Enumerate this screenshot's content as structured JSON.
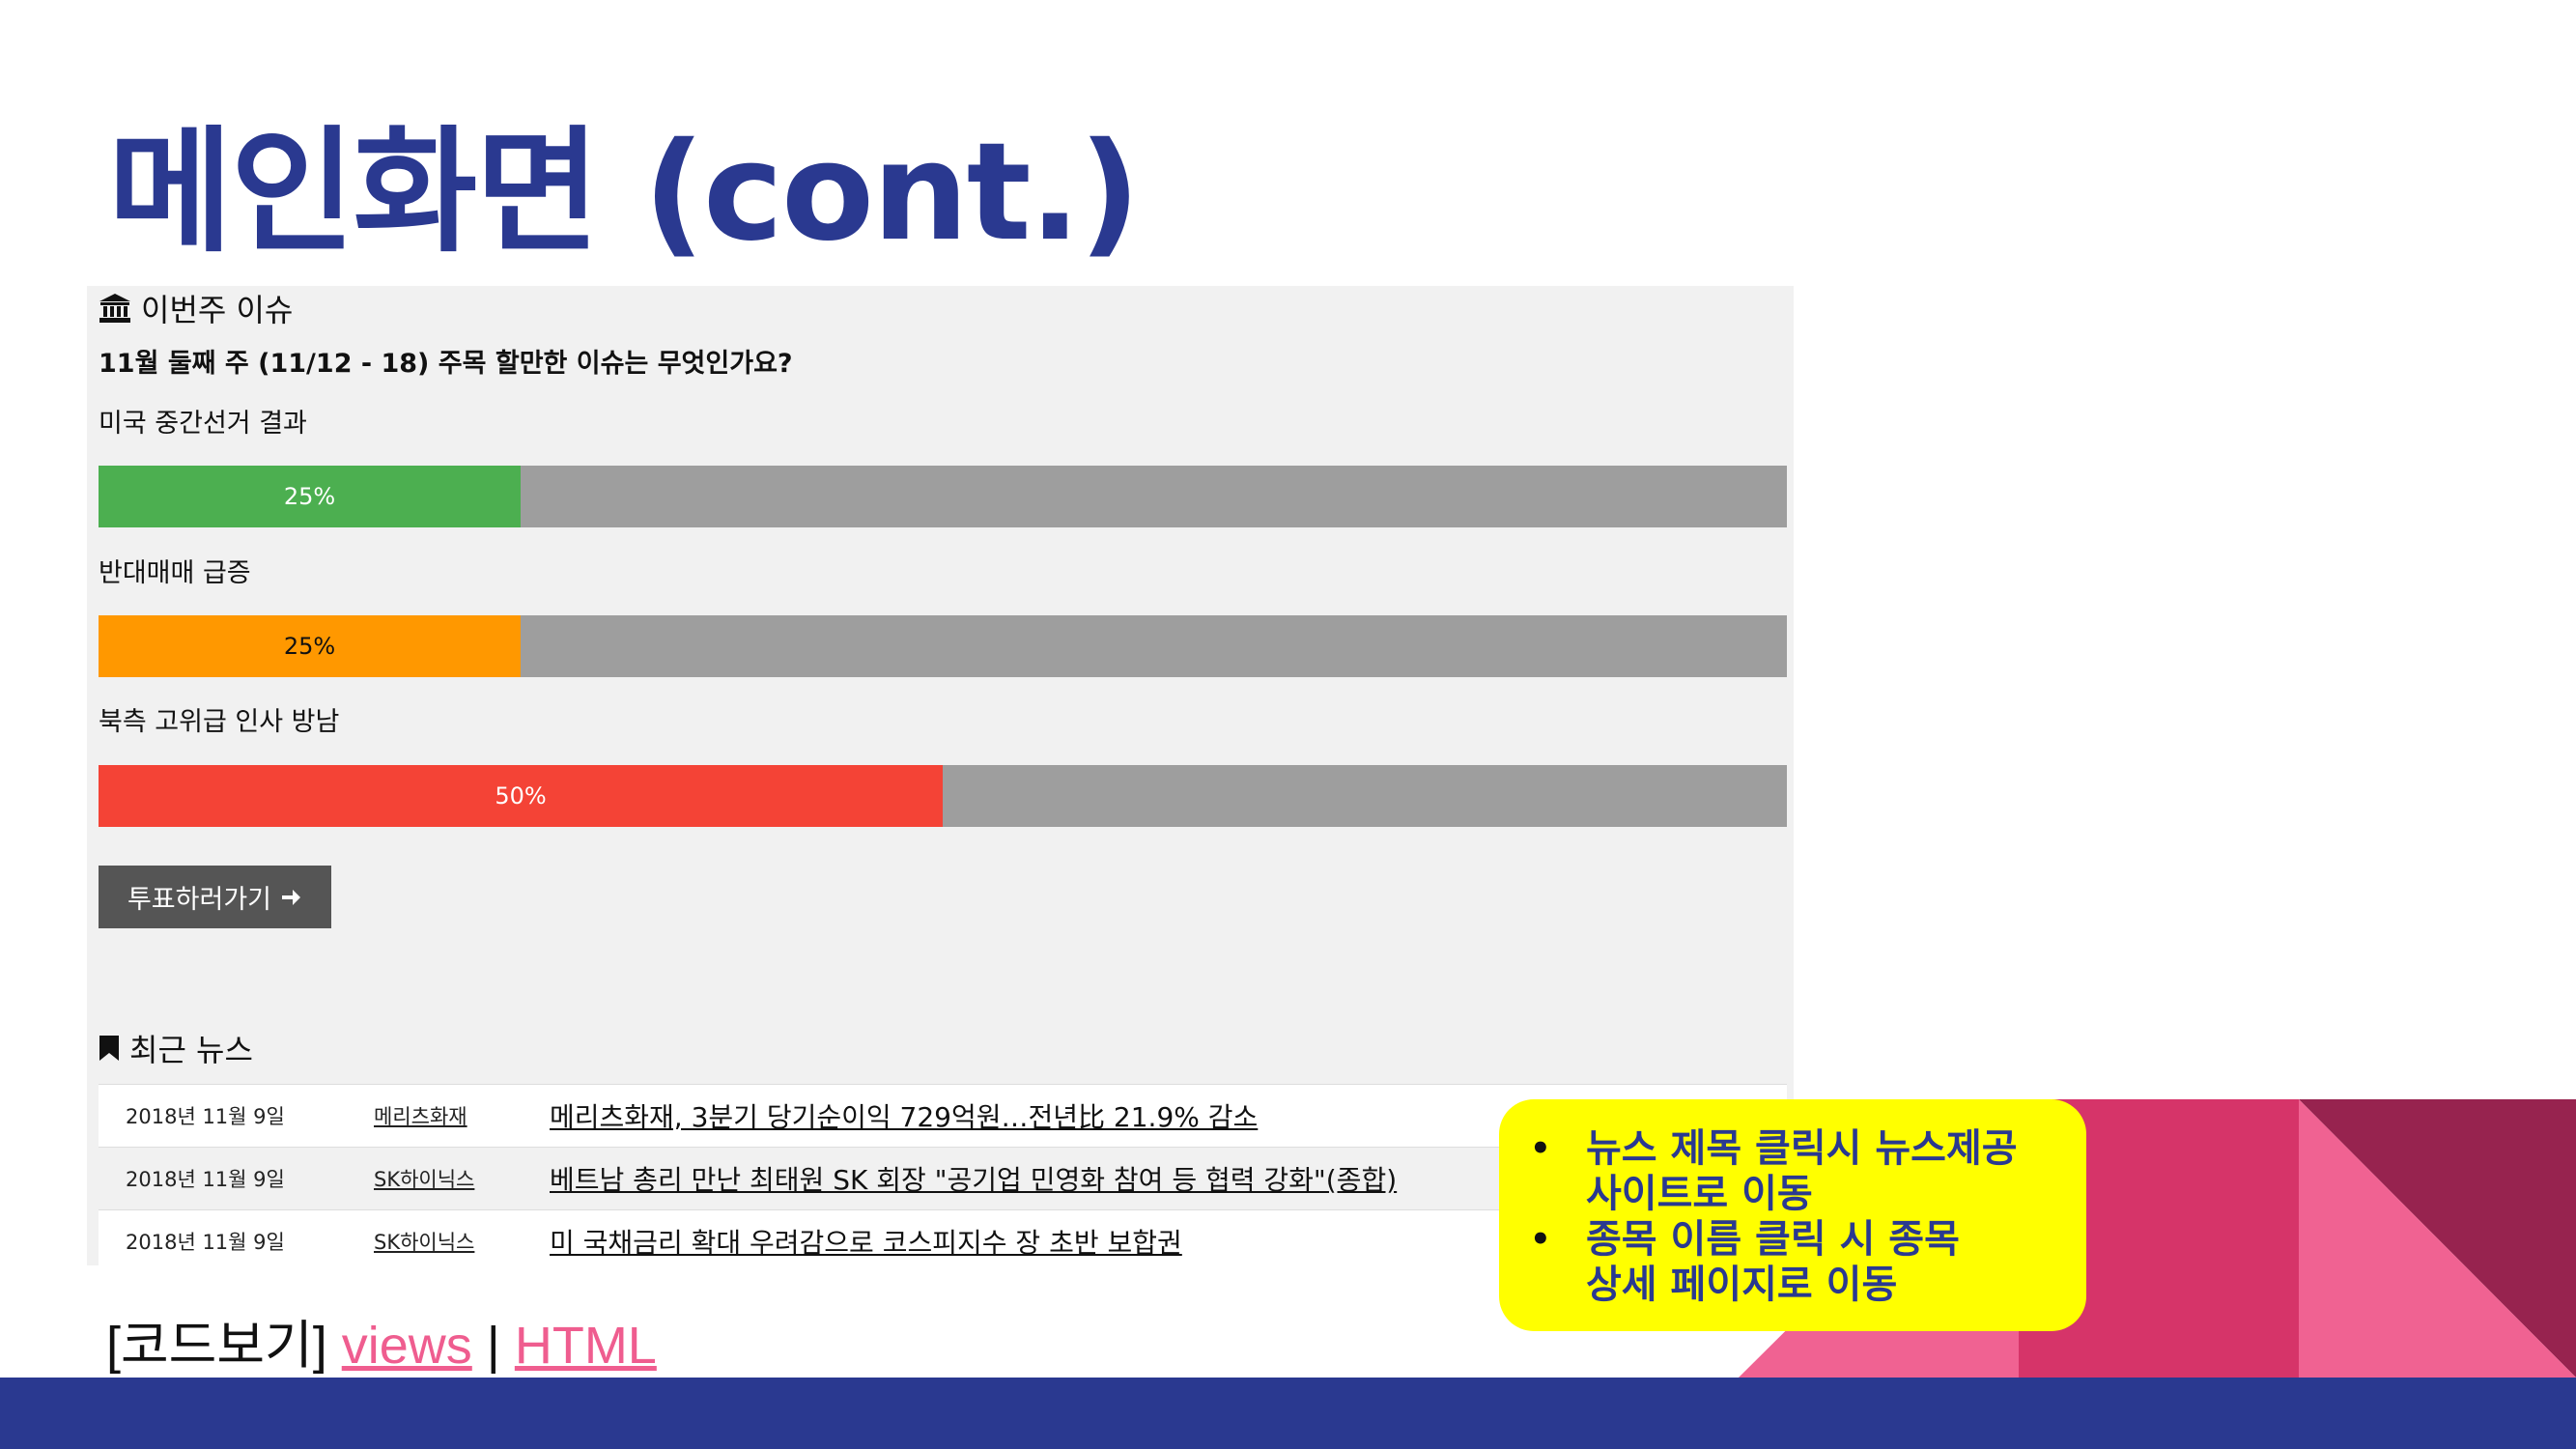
{
  "slide": {
    "title": "메인화면 (cont.)",
    "code_prefix": "[코드보기]",
    "code_link_views": "views",
    "code_separator": "|",
    "code_link_html": "HTML"
  },
  "poll": {
    "header": "이번주 이슈",
    "question": "11월 둘째 주 (11/12 - 18) 주목 할만한 이슈는 무엇인가요?",
    "options": [
      {
        "label": "미국 중간선거 결과",
        "percent": 25,
        "text": "25%",
        "color": "#4caf50",
        "text_color": "#ffffff"
      },
      {
        "label": "반대매매 급증",
        "percent": 25,
        "text": "25%",
        "color": "#ff9800",
        "text_color": "#111111"
      },
      {
        "label": "북측 고위급 인사 방남",
        "percent": 50,
        "text": "50%",
        "color": "#f44336",
        "text_color": "#ffffff"
      }
    ],
    "vote_button": "투표하러가기"
  },
  "news": {
    "header": "최근 뉴스",
    "rows": [
      {
        "date": "2018년 11월 9일",
        "stock": "메리츠화재",
        "title": "메리츠화재, 3분기 당기순이익 729억원…전년比 21.9% 감소"
      },
      {
        "date": "2018년 11월 9일",
        "stock": "SK하이닉스",
        "title": "베트남 총리 만난 최태원 SK 회장 \"공기업 민영화 참여 등 협력 강화\"(종합)"
      },
      {
        "date": "2018년 11월 9일",
        "stock": "SK하이닉스",
        "title": "미 국채금리 확대 우려감으로 코스피지수 장 초반 보합권"
      }
    ]
  },
  "callout": {
    "items": [
      {
        "line1": "뉴스 제목 클릭시 뉴스제공",
        "line2": "사이트로 이동"
      },
      {
        "line1": "종목 이름 클릭 시 종목",
        "line2": "상세 페이지로 이동"
      }
    ]
  },
  "colors": {
    "accent_navy": "#2a3990",
    "link_pink": "#ef5d8f",
    "callout_yellow": "#ffff00",
    "deco_pink_light": "#f06292",
    "deco_pink_mid": "#d63469",
    "deco_pink_dark": "#97234f",
    "progress_track": "#9e9e9e",
    "button_gray": "#555555"
  },
  "icons": {
    "poll_header": "institution-icon",
    "news_header": "bookmark-icon",
    "vote_button": "arrow-right-icon"
  }
}
